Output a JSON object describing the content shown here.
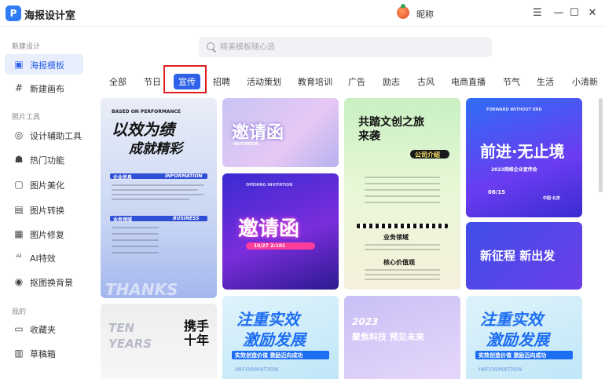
{
  "app": {
    "title": "海报设计室",
    "logo_char": "P",
    "user_name": "昵称"
  },
  "window_controls": {
    "menu": "☰",
    "minimize": "—",
    "maximize": "☐",
    "close": "✕"
  },
  "sidebar": {
    "groups": [
      {
        "label": "新建设计"
      },
      {
        "label": "照片工具"
      },
      {
        "label": "我的"
      }
    ],
    "items": [
      {
        "label": "海报模板",
        "icon": "image-icon",
        "glyph": "▣"
      },
      {
        "label": "新建画布",
        "icon": "hash-icon",
        "glyph": "#"
      },
      {
        "label": "设计辅助工具",
        "icon": "compass-icon",
        "glyph": "◎"
      },
      {
        "label": "热门功能",
        "icon": "fire-icon",
        "glyph": "☗"
      },
      {
        "label": "图片美化",
        "icon": "photo-icon",
        "glyph": "▢"
      },
      {
        "label": "图片转换",
        "icon": "convert-icon",
        "glyph": "▤"
      },
      {
        "label": "图片修复",
        "icon": "repair-icon",
        "glyph": "▦"
      },
      {
        "label": "AI特效",
        "icon": "ai-icon",
        "glyph": "ᴬᴵ"
      },
      {
        "label": "抠图换背景",
        "icon": "cutout-icon",
        "glyph": "◉"
      },
      {
        "label": "收藏夹",
        "icon": "folder-icon",
        "glyph": "▭"
      },
      {
        "label": "草稿箱",
        "icon": "draft-icon",
        "glyph": "▥"
      }
    ]
  },
  "search": {
    "placeholder": "精美模板随心选"
  },
  "tabs": [
    "全部",
    "节日",
    "宣传",
    "招聘",
    "活动策划",
    "教育培训",
    "广告",
    "励志",
    "古风",
    "电商直播",
    "节气",
    "生活",
    "小清新"
  ],
  "active_tab": "宣传",
  "cards": {
    "c1": {
      "top": "BASED ON PERFORMANCE",
      "title1": "以效为绩",
      "title2": "成就精彩",
      "sub1": "企业信息",
      "sub2": "INFORMATION",
      "sub3": "业务领域",
      "sub4": "BUSINESS",
      "bottom": "THANKS"
    },
    "c2": {
      "title": "邀请函",
      "sub": "INVITATION"
    },
    "c3": {
      "top": "OPENING INVITATION",
      "title": "邀请函",
      "date": "10/27 2:101"
    },
    "c4": {
      "title1": "共踏文创之旅",
      "title2": "来袭",
      "badge": "公司介绍",
      "sec1": "业务领域",
      "sec2": "核心价值观"
    },
    "c5": {
      "top": "FORWARD WITHOUT END",
      "title": "前进·无止境",
      "sub": "2023网络企业宣传会",
      "date": "08/15",
      "place": "中国·北京"
    },
    "c6": {
      "title": "新征程 新出发"
    },
    "c7": {
      "title1": "TEN",
      "title2": "YEARS",
      "title3": "携手十年"
    },
    "c8": {
      "title1": "注重实效",
      "title2": "激励发展",
      "sub": "实效创造价值 激励迈向成功",
      "foot": "INFORMATION"
    },
    "c9": {
      "year": "2023",
      "title": "聚焦科技 预见未来"
    },
    "c10": {
      "title1": "注重实效",
      "title2": "激励发展",
      "sub": "实效创造价值 激励迈向成功",
      "foot": "INFORMATION"
    }
  },
  "colors": {
    "accent": "#2f62e8",
    "highlight": "#e02020"
  }
}
